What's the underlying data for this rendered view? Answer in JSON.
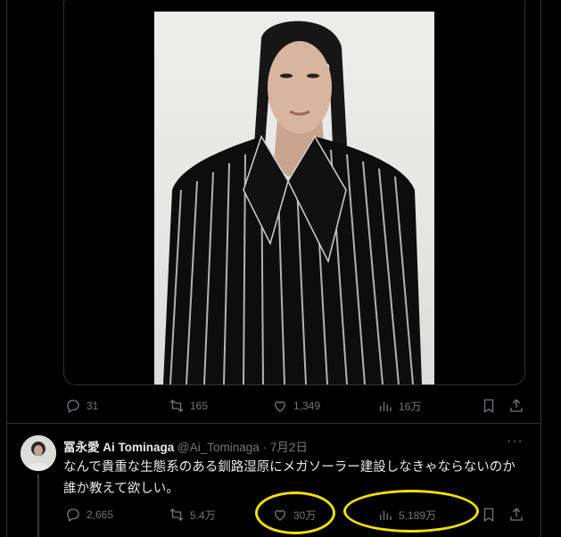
{
  "top_tweet": {
    "actions": {
      "reply_count": "31",
      "repost_count": "165",
      "like_count": "1,349",
      "views_count": "16万"
    },
    "image_icon_names": [
      "reply-icon",
      "repost-icon",
      "like-icon",
      "views-icon",
      "bookmark-icon",
      "share-icon"
    ]
  },
  "reply_tweet": {
    "display_name": "冨永愛 Ai Tominaga",
    "handle": "@Ai_Tominaga",
    "separator": "·",
    "date": "7月2日",
    "more": "···",
    "text": "なんで貴重な生態系のある釧路湿原にメガソーラー建設しなきゃならないのか誰か教えて欲しい。",
    "actions": {
      "reply_count": "2,665",
      "repost_count": "5.4万",
      "like_count": "30万",
      "views_count": "5,189万"
    }
  },
  "annotations": {
    "highlight_color": "#f5e000",
    "highlighted_items": [
      "like_count",
      "views_count"
    ]
  },
  "colors": {
    "background": "#000000",
    "text": "#e7e9ea",
    "muted": "#71767b",
    "border": "#2f3336"
  }
}
